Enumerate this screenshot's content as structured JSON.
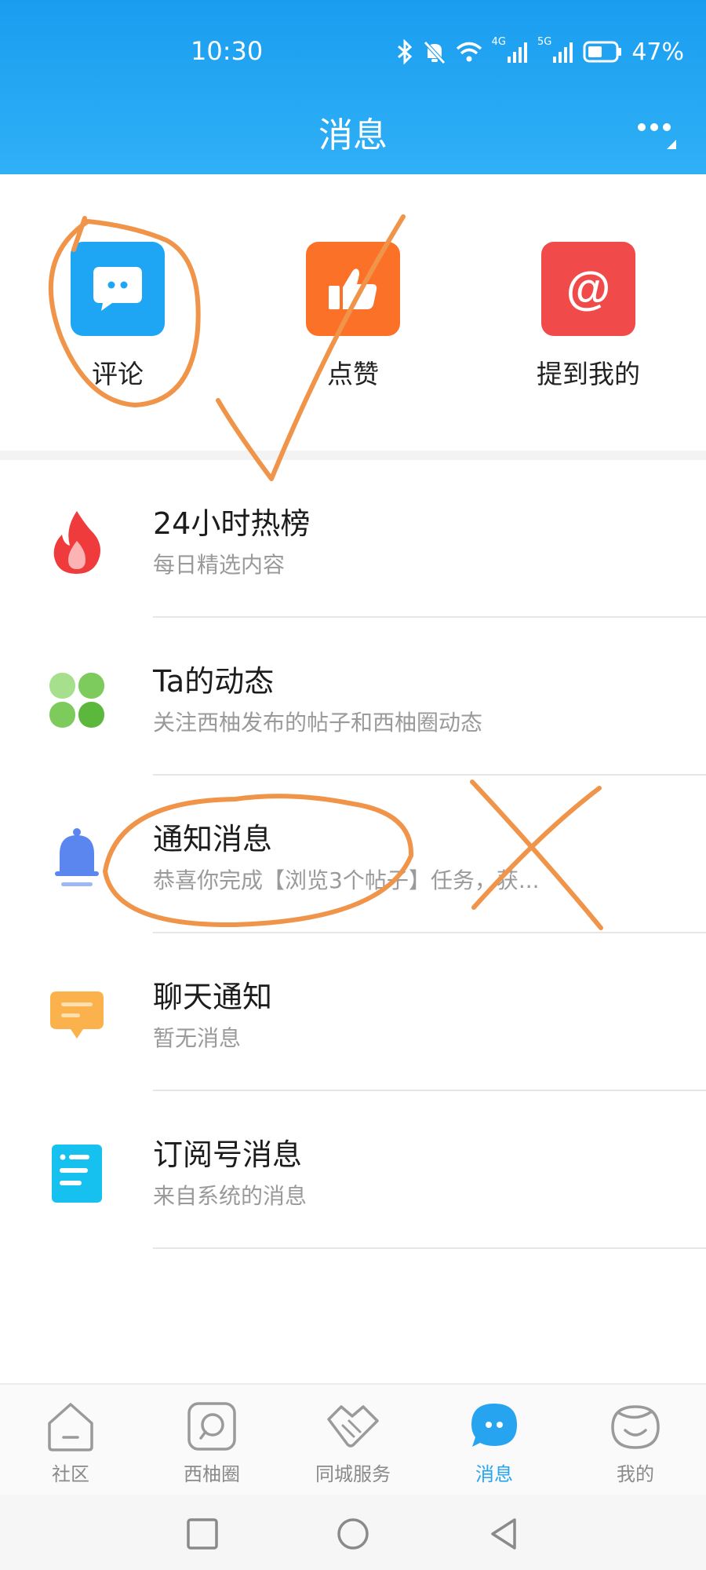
{
  "status_bar": {
    "time": "10:30",
    "network_left": "4G",
    "network_right": "5G",
    "battery": "47%"
  },
  "header": {
    "title": "消息"
  },
  "categories": [
    {
      "label": "评论",
      "icon": "comment-icon",
      "color": "#1ea6f5"
    },
    {
      "label": "点赞",
      "icon": "thumbs-up-icon",
      "color": "#fb7128"
    },
    {
      "label": "提到我的",
      "icon": "at-icon",
      "color": "#f04a4a"
    }
  ],
  "list": [
    {
      "title": "24小时热榜",
      "subtitle": "每日精选内容",
      "icon": "fire-icon"
    },
    {
      "title": "Ta的动态",
      "subtitle": "关注西柚发布的帖子和西柚圈动态",
      "icon": "clover-icon"
    },
    {
      "title": "通知消息",
      "subtitle": "恭喜你完成【浏览3个帖子】任务，获...",
      "icon": "bell-icon"
    },
    {
      "title": "聊天通知",
      "subtitle": "暂无消息",
      "icon": "chat-bubble-icon"
    },
    {
      "title": "订阅号消息",
      "subtitle": "来自系统的消息",
      "icon": "document-icon"
    }
  ],
  "bottom_nav": [
    {
      "label": "社区",
      "icon": "home-icon",
      "active": false
    },
    {
      "label": "西柚圈",
      "icon": "circle-chat-icon",
      "active": false
    },
    {
      "label": "同城服务",
      "icon": "handshake-icon",
      "active": false
    },
    {
      "label": "消息",
      "icon": "message-icon",
      "active": true
    },
    {
      "label": "我的",
      "icon": "profile-icon",
      "active": false
    }
  ],
  "colors": {
    "header": "#1a9df0",
    "accent": "#27a4ef",
    "annotation": "#f0944a"
  }
}
